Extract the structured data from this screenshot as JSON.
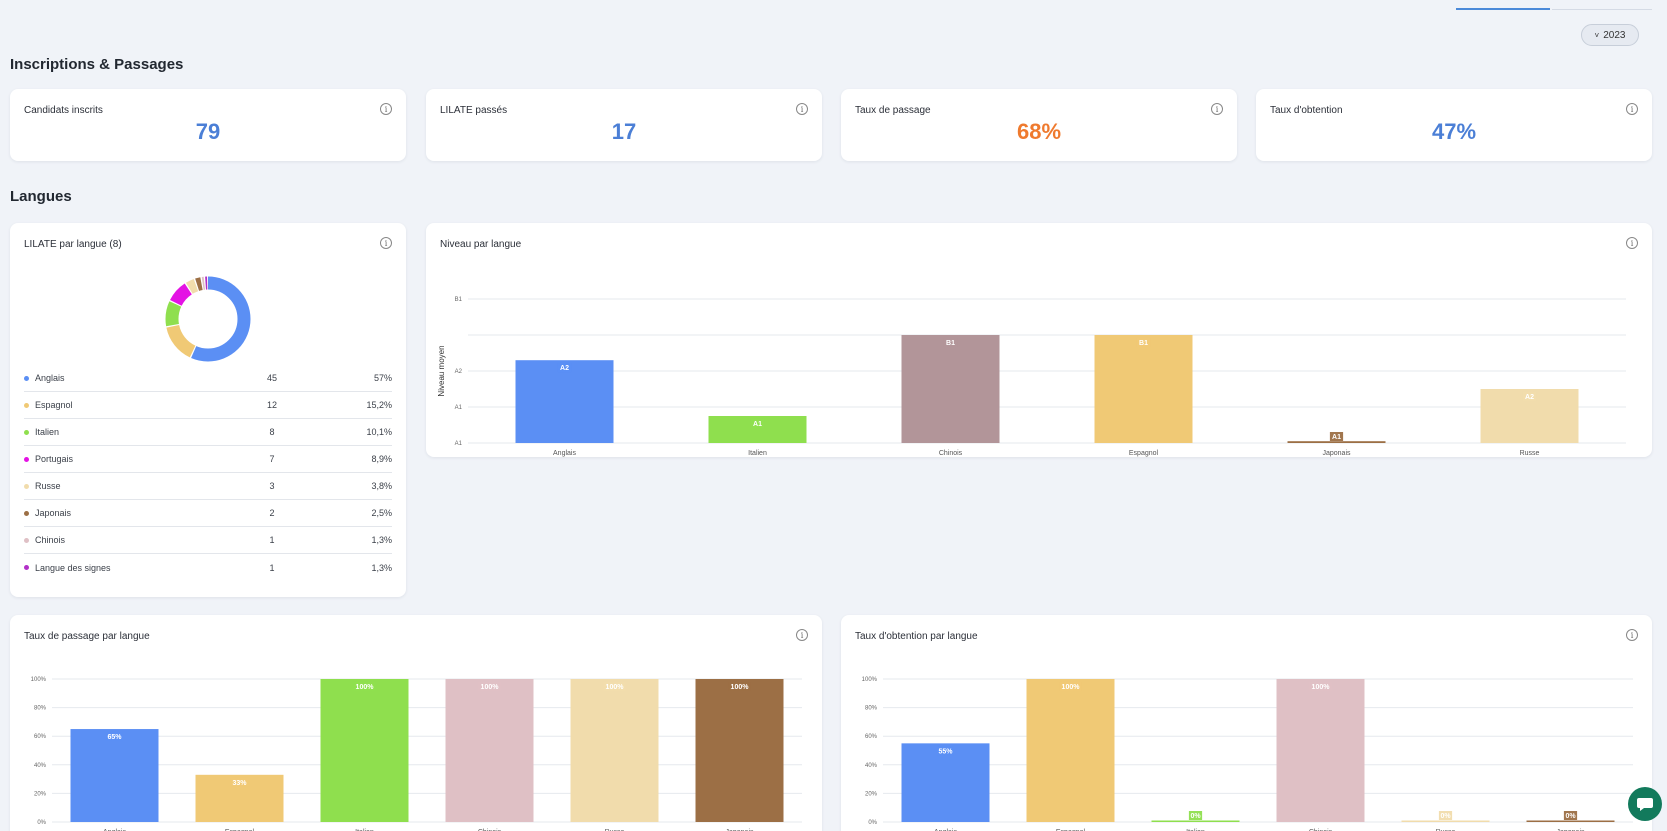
{
  "header": {
    "year": "2023"
  },
  "sections": {
    "inscriptions": "Inscriptions & Passages",
    "langues": "Langues"
  },
  "kpis": [
    {
      "label": "Candidats inscrits",
      "value": "79",
      "color": "#4b7fd6"
    },
    {
      "label": "LILATE passés",
      "value": "17",
      "color": "#4b7fd6"
    },
    {
      "label": "Taux de passage",
      "value": "68%",
      "color": "#ef7a2e"
    },
    {
      "label": "Taux d'obtention",
      "value": "47%",
      "color": "#4b7fd6"
    }
  ],
  "colors": {
    "Anglais": "#5b8ff4",
    "Espagnol": "#f0c975",
    "Italien": "#8fdf4e",
    "Portugais": "#e412e4",
    "Russe": "#f1dcac",
    "Japonais": "#9c6f45",
    "Chinois": "#dfc0c5",
    "ChinoisNiveau": "#b29599",
    "Langue des signes": "#b230c8"
  },
  "donut": {
    "title": "LILATE par langue (8)",
    "items": [
      {
        "name": "Anglais",
        "count": "45",
        "pct": "57%",
        "value": 45,
        "color": "#5b8ff4"
      },
      {
        "name": "Espagnol",
        "count": "12",
        "pct": "15,2%",
        "value": 12,
        "color": "#f0c975"
      },
      {
        "name": "Italien",
        "count": "8",
        "pct": "10,1%",
        "value": 8,
        "color": "#8fdf4e"
      },
      {
        "name": "Portugais",
        "count": "7",
        "pct": "8,9%",
        "value": 7,
        "color": "#e412e4"
      },
      {
        "name": "Russe",
        "count": "3",
        "pct": "3,8%",
        "value": 3,
        "color": "#f1dcac"
      },
      {
        "name": "Japonais",
        "count": "2",
        "pct": "2,5%",
        "value": 2,
        "color": "#9c6f45"
      },
      {
        "name": "Chinois",
        "count": "1",
        "pct": "1,3%",
        "value": 1,
        "color": "#dfc0c5"
      },
      {
        "name": "Langue des signes",
        "count": "1",
        "pct": "1,3%",
        "value": 1,
        "color": "#b230c8"
      }
    ]
  },
  "chart_data": [
    {
      "type": "bar",
      "title": "Niveau par langue",
      "ylabel": "Niveau moyen",
      "y_ticks": [
        "A1",
        "A1",
        "A2",
        "",
        "B1"
      ],
      "categories": [
        "Anglais",
        "Italien",
        "Chinois",
        "Espagnol",
        "Japonais",
        "Russe"
      ],
      "values": [
        2.3,
        0.75,
        3.0,
        3.0,
        0.05,
        1.5
      ],
      "ylim": [
        0,
        4
      ],
      "labels": [
        "A2",
        "A1",
        "B1",
        "B1",
        "A1",
        "A2"
      ],
      "colors": [
        "#5b8ff4",
        "#8fdf4e",
        "#b29599",
        "#f0c975",
        "#9c6f45",
        "#f1dcac"
      ],
      "grid": true
    },
    {
      "type": "bar",
      "title": "Taux de passage par langue",
      "y_ticks": [
        "0%",
        "20%",
        "40%",
        "60%",
        "80%",
        "100%"
      ],
      "categories": [
        "Anglais",
        "Espagnol",
        "Italien",
        "Chinois",
        "Russe",
        "Japonais"
      ],
      "values": [
        65,
        33,
        100,
        100,
        100,
        100
      ],
      "ylim": [
        0,
        100
      ],
      "labels": [
        "65%",
        "33%",
        "100%",
        "100%",
        "100%",
        "100%"
      ],
      "colors": [
        "#5b8ff4",
        "#f0c975",
        "#8fdf4e",
        "#dfc0c5",
        "#f1dcac",
        "#9c6f45"
      ],
      "grid": true
    },
    {
      "type": "bar",
      "title": "Taux d'obtention par langue",
      "y_ticks": [
        "0%",
        "20%",
        "40%",
        "60%",
        "80%",
        "100%"
      ],
      "categories": [
        "Anglais",
        "Espagnol",
        "Italien",
        "Chinois",
        "Russe",
        "Japonais"
      ],
      "values": [
        55,
        100,
        0,
        100,
        0,
        0
      ],
      "ylim": [
        0,
        100
      ],
      "labels": [
        "55%",
        "100%",
        "0%",
        "100%",
        "0%",
        "0%"
      ],
      "colors": [
        "#5b8ff4",
        "#f0c975",
        "#8fdf4e",
        "#dfc0c5",
        "#f1dcac",
        "#9c6f45"
      ],
      "grid": true
    }
  ]
}
